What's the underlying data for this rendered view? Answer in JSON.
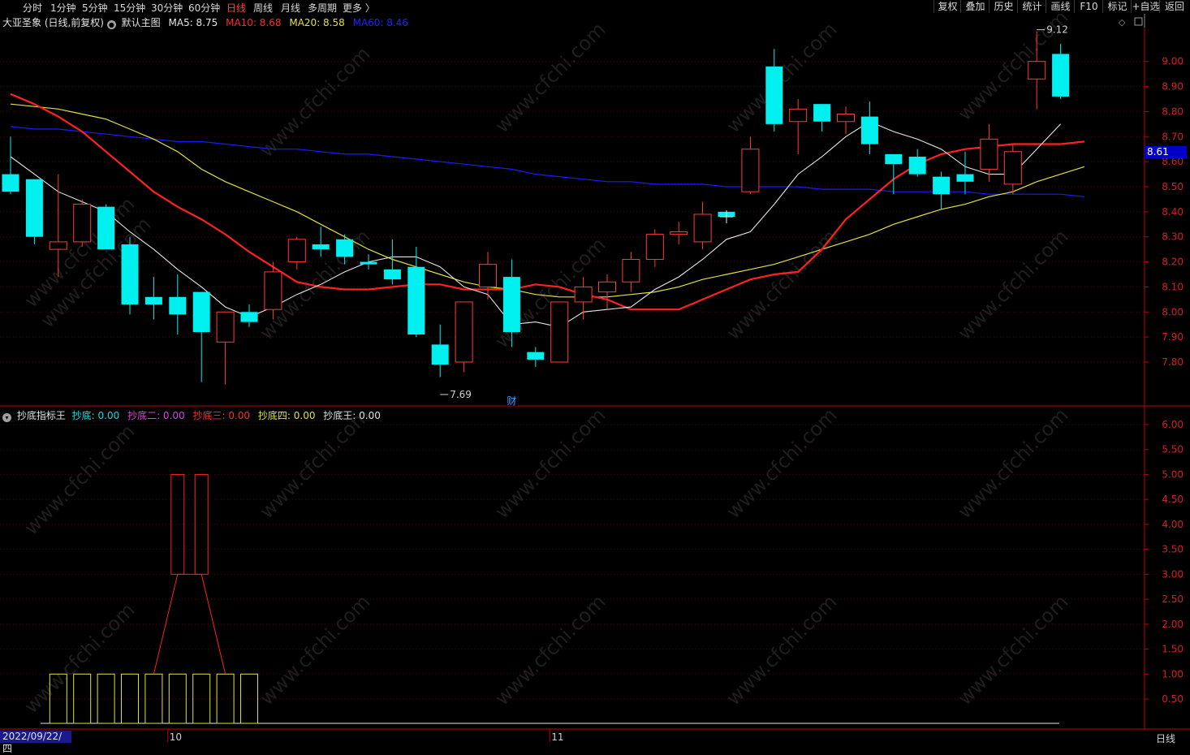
{
  "nav": {
    "tabs": [
      "分时",
      "1分钟",
      "5分钟",
      "15分钟",
      "30分钟",
      "60分钟",
      "日线",
      "周线",
      "月线",
      "多周期",
      "更多 〉"
    ],
    "active_tab": "日线",
    "toolbar": [
      "复权",
      "叠加",
      "历史",
      "统计",
      "画线",
      "F10",
      "标记",
      "+自选",
      "返回"
    ]
  },
  "main_header": {
    "stock": "大亚圣象 (日线,前复权)",
    "template": "默认主图",
    "ma5": "MA5: 8.75",
    "ma10": "MA10: 8.68",
    "ma20": "MA20: 8.58",
    "ma60": "MA60: 8.46"
  },
  "sub_header": {
    "name": "抄底指标王",
    "l1": "抄底: 0.00",
    "l2": "抄底二: 0.00",
    "l3": "抄底三: 0.00",
    "l4": "抄底四: 0.00",
    "l5": "抄底王: 0.00"
  },
  "current_price": "8.61",
  "annotations": {
    "low": "7.69",
    "high": "9.12",
    "event": "财"
  },
  "bottom": {
    "date": "2022/09/22/四",
    "right": "日线"
  },
  "xlabels": [
    {
      "i": 7,
      "text": "10"
    },
    {
      "i": 23,
      "text": "11"
    }
  ],
  "colors": {
    "up": "#ff3a3a",
    "down": "#00f0f0",
    "ma5": "#e6e6e6",
    "ma10": "#ff2020",
    "ma20": "#e0e040",
    "ma60": "#1a1aff",
    "grid": "#5a0000",
    "axis": "#c00000"
  },
  "chart_data": {
    "type": "candlestick",
    "main": {
      "ylim": [
        7.61,
        9.27
      ],
      "yticks": [
        "9.00",
        "8.90",
        "8.80",
        "8.70",
        "8.60",
        "8.50",
        "8.40",
        "8.30",
        "8.20",
        "8.10",
        "8.00",
        "7.90",
        "7.80"
      ],
      "candles": [
        {
          "o": 8.55,
          "h": 8.7,
          "l": 8.47,
          "c": 8.48
        },
        {
          "o": 8.53,
          "h": 8.53,
          "l": 8.27,
          "c": 8.3
        },
        {
          "o": 8.25,
          "h": 8.55,
          "l": 8.14,
          "c": 8.28
        },
        {
          "o": 8.28,
          "h": 8.45,
          "l": 8.26,
          "c": 8.43
        },
        {
          "o": 8.42,
          "h": 8.43,
          "l": 8.25,
          "c": 8.25
        },
        {
          "o": 8.27,
          "h": 8.3,
          "l": 7.99,
          "c": 8.03
        },
        {
          "o": 8.06,
          "h": 8.14,
          "l": 7.97,
          "c": 8.03
        },
        {
          "o": 8.06,
          "h": 8.15,
          "l": 7.91,
          "c": 7.99
        },
        {
          "o": 8.08,
          "h": 8.08,
          "l": 7.72,
          "c": 7.92
        },
        {
          "o": 7.88,
          "h": 8.0,
          "l": 7.71,
          "c": 8.0
        },
        {
          "o": 8.0,
          "h": 8.03,
          "l": 7.94,
          "c": 7.96
        },
        {
          "o": 8.01,
          "h": 8.2,
          "l": 7.97,
          "c": 8.16
        },
        {
          "o": 8.2,
          "h": 8.3,
          "l": 8.17,
          "c": 8.29
        },
        {
          "o": 8.27,
          "h": 8.34,
          "l": 8.22,
          "c": 8.25
        },
        {
          "o": 8.29,
          "h": 8.31,
          "l": 8.19,
          "c": 8.22
        },
        {
          "o": 8.2,
          "h": 8.23,
          "l": 8.17,
          "c": 8.19
        },
        {
          "o": 8.17,
          "h": 8.29,
          "l": 8.11,
          "c": 8.13
        },
        {
          "o": 8.18,
          "h": 8.26,
          "l": 7.9,
          "c": 7.91
        },
        {
          "o": 7.87,
          "h": 7.95,
          "l": 7.74,
          "c": 7.79
        },
        {
          "o": 7.8,
          "h": 8.04,
          "l": 7.76,
          "c": 8.04
        },
        {
          "o": 8.1,
          "h": 8.24,
          "l": 8.05,
          "c": 8.19
        },
        {
          "o": 8.14,
          "h": 8.21,
          "l": 7.86,
          "c": 7.92
        },
        {
          "o": 7.84,
          "h": 7.86,
          "l": 7.78,
          "c": 7.81
        },
        {
          "o": 7.8,
          "h": 8.04,
          "l": 7.8,
          "c": 8.04
        },
        {
          "o": 8.04,
          "h": 8.14,
          "l": 7.97,
          "c": 8.1
        },
        {
          "o": 8.08,
          "h": 8.15,
          "l": 8.01,
          "c": 8.12
        },
        {
          "o": 8.12,
          "h": 8.24,
          "l": 8.08,
          "c": 8.21
        },
        {
          "o": 8.21,
          "h": 8.33,
          "l": 8.18,
          "c": 8.31
        },
        {
          "o": 8.31,
          "h": 8.36,
          "l": 8.27,
          "c": 8.32
        },
        {
          "o": 8.28,
          "h": 8.44,
          "l": 8.25,
          "c": 8.39
        },
        {
          "o": 8.4,
          "h": 8.4,
          "l": 8.36,
          "c": 8.38
        },
        {
          "o": 8.48,
          "h": 8.7,
          "l": 8.47,
          "c": 8.65
        },
        {
          "o": 8.98,
          "h": 9.05,
          "l": 8.72,
          "c": 8.75
        },
        {
          "o": 8.76,
          "h": 8.85,
          "l": 8.63,
          "c": 8.81
        },
        {
          "o": 8.83,
          "h": 8.83,
          "l": 8.72,
          "c": 8.76
        },
        {
          "o": 8.76,
          "h": 8.82,
          "l": 8.71,
          "c": 8.79
        },
        {
          "o": 8.78,
          "h": 8.84,
          "l": 8.63,
          "c": 8.67
        },
        {
          "o": 8.63,
          "h": 8.63,
          "l": 8.47,
          "c": 8.59
        },
        {
          "o": 8.62,
          "h": 8.65,
          "l": 8.54,
          "c": 8.55
        },
        {
          "o": 8.54,
          "h": 8.56,
          "l": 8.41,
          "c": 8.47
        },
        {
          "o": 8.55,
          "h": 8.64,
          "l": 8.47,
          "c": 8.52
        },
        {
          "o": 8.57,
          "h": 8.75,
          "l": 8.52,
          "c": 8.69
        },
        {
          "o": 8.51,
          "h": 8.67,
          "l": 8.47,
          "c": 8.64
        },
        {
          "o": 8.93,
          "h": 9.12,
          "l": 8.81,
          "c": 9.0
        },
        {
          "o": 9.03,
          "h": 9.07,
          "l": 8.85,
          "c": 8.86
        }
      ],
      "ma5": [
        8.62,
        8.55,
        8.48,
        8.44,
        8.4,
        8.32,
        8.25,
        8.17,
        8.1,
        8.02,
        7.98,
        8.02,
        8.07,
        8.11,
        8.16,
        8.2,
        8.22,
        8.22,
        8.18,
        8.1,
        8.07,
        7.95,
        7.96,
        7.94,
        8.0,
        8.01,
        8.02,
        8.09,
        8.14,
        8.21,
        8.29,
        8.32,
        8.43,
        8.55,
        8.62,
        8.7,
        8.76,
        8.72,
        8.69,
        8.65,
        8.58,
        8.55,
        8.55,
        8.65,
        8.75
      ],
      "ma10": [
        8.87,
        8.83,
        8.78,
        8.72,
        8.64,
        8.56,
        8.48,
        8.42,
        8.37,
        8.31,
        8.24,
        8.18,
        8.12,
        8.1,
        8.09,
        8.09,
        8.1,
        8.11,
        8.11,
        8.09,
        8.09,
        8.09,
        8.11,
        8.1,
        8.07,
        8.05,
        8.01,
        8.01,
        8.01,
        8.05,
        8.09,
        8.13,
        8.15,
        8.16,
        8.25,
        8.37,
        8.45,
        8.53,
        8.59,
        8.63,
        8.65,
        8.66,
        8.67,
        8.67,
        8.67,
        8.68
      ],
      "ma20": [
        8.83,
        8.82,
        8.81,
        8.79,
        8.77,
        8.73,
        8.69,
        8.64,
        8.57,
        8.52,
        8.48,
        8.44,
        8.4,
        8.35,
        8.3,
        8.25,
        8.21,
        8.18,
        8.15,
        8.12,
        8.1,
        8.09,
        8.07,
        8.06,
        8.06,
        8.06,
        8.07,
        8.08,
        8.1,
        8.13,
        8.15,
        8.17,
        8.19,
        8.22,
        8.25,
        8.28,
        8.31,
        8.35,
        8.38,
        8.41,
        8.43,
        8.46,
        8.48,
        8.52,
        8.55,
        8.58
      ],
      "ma60": [
        8.74,
        8.73,
        8.73,
        8.72,
        8.71,
        8.7,
        8.69,
        8.68,
        8.68,
        8.67,
        8.66,
        8.65,
        8.65,
        8.64,
        8.63,
        8.63,
        8.62,
        8.61,
        8.6,
        8.59,
        8.58,
        8.57,
        8.55,
        8.54,
        8.53,
        8.52,
        8.52,
        8.51,
        8.51,
        8.51,
        8.5,
        8.5,
        8.5,
        8.5,
        8.49,
        8.49,
        8.49,
        8.48,
        8.48,
        8.48,
        8.48,
        8.47,
        8.47,
        8.47,
        8.47,
        8.46
      ]
    },
    "sub": {
      "ylim": [
        0,
        6.17
      ],
      "yticks": [
        "6.00",
        "5.50",
        "5.00",
        "4.50",
        "4.00",
        "3.50",
        "3.00",
        "2.50",
        "2.00",
        "1.50",
        "1.00",
        "0.50"
      ],
      "box_indices": [
        2,
        3,
        4,
        5,
        6,
        7,
        8,
        9,
        10
      ],
      "box_value": 1.0,
      "red_points": [
        [
          6,
          0
        ],
        [
          7,
          3
        ],
        [
          8,
          3
        ],
        [
          9,
          0
        ]
      ],
      "high_boxes": [
        {
          "from": 7,
          "to": 8,
          "lo": 3,
          "hi": 5
        }
      ]
    }
  }
}
